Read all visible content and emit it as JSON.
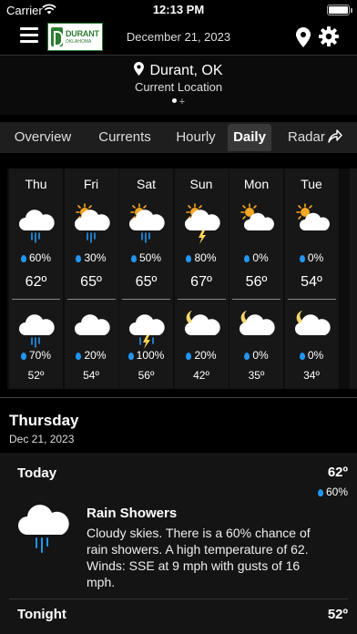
{
  "status_bar": {
    "carrier": "Carrier",
    "time": "12:13 PM"
  },
  "header": {
    "logo_name": "DURANT",
    "logo_sub": "OKLAHOMA",
    "date": "December 21, 2023",
    "icons": [
      "menu-icon",
      "location-pin-icon",
      "gear-icon"
    ]
  },
  "location": {
    "city": "Durant, OK",
    "label": "Current Location",
    "add": "+"
  },
  "tabs": [
    {
      "label": "Overview",
      "active": false
    },
    {
      "label": "Currents",
      "active": false
    },
    {
      "label": "Hourly",
      "active": false
    },
    {
      "label": "Daily",
      "active": true
    },
    {
      "label": "Radar",
      "active": false
    }
  ],
  "forecast": [
    {
      "day": "Thu",
      "day_icon": "rain-cloud",
      "day_precip": "60%",
      "high": "62º",
      "night_icon": "rain-cloud",
      "night_precip": "70%",
      "low": "52º"
    },
    {
      "day": "Fri",
      "day_icon": "sun-rain-cloud",
      "day_precip": "30%",
      "high": "65º",
      "night_icon": "cloud",
      "night_precip": "20%",
      "low": "54º"
    },
    {
      "day": "Sat",
      "day_icon": "sun-rain-cloud",
      "day_precip": "50%",
      "high": "65º",
      "night_icon": "thunder-rain-cloud",
      "night_precip": "100%",
      "low": "56º"
    },
    {
      "day": "Sun",
      "day_icon": "sun-thunder-cloud",
      "day_precip": "80%",
      "high": "67º",
      "night_icon": "moon-cloud",
      "night_precip": "20%",
      "low": "42º"
    },
    {
      "day": "Mon",
      "day_icon": "sun-cloud",
      "day_precip": "0%",
      "high": "56º",
      "night_icon": "moon-cloud",
      "night_precip": "0%",
      "low": "35º"
    },
    {
      "day": "Tue",
      "day_icon": "sun-cloud",
      "day_precip": "0%",
      "high": "54º",
      "night_icon": "moon-cloud",
      "night_precip": "0%",
      "low": "34º"
    }
  ],
  "detail": {
    "day": "Thursday",
    "date": "Dec 21, 2023",
    "period": "Today",
    "temp": "62º",
    "precip": "60%",
    "condition": "Rain Showers",
    "description": "Cloudy skies. There is a 60% chance of rain showers. A high temperature of 62. Winds: SSE at 9 mph with gusts of 16 mph.",
    "next_period": "Tonight",
    "next_temp": "52º"
  },
  "colors": {
    "accent": "#2196f3",
    "logo_green": "#2e7d32",
    "sun": "#f5a623"
  }
}
